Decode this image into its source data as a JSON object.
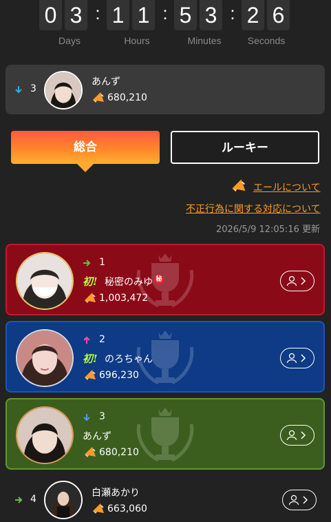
{
  "countdown": {
    "days": [
      "0",
      "3"
    ],
    "hours": [
      "1",
      "1"
    ],
    "minutes": [
      "5",
      "3"
    ],
    "seconds": [
      "2",
      "6"
    ],
    "labels": {
      "days": "Days",
      "hours": "Hours",
      "minutes": "Minutes",
      "seconds": "Seconds"
    }
  },
  "my_rank": {
    "rank": "3",
    "trend": "down",
    "name": "あんず",
    "points": "680,210"
  },
  "tabs": [
    {
      "label": "総合",
      "active": true
    },
    {
      "label": "ルーキー",
      "active": false
    }
  ],
  "links": {
    "yell_about": "エールについて",
    "fraud_policy": "不正行為に関する対応について"
  },
  "updated_at": "2026/5/9 12:05:16 更新",
  "ranking": [
    {
      "rank": "1",
      "trend": "flat",
      "first_badge": "初!",
      "name": "秘密のみゆ",
      "secret_badge": "秘",
      "points": "1,003,472",
      "card_color": "#8b0a18",
      "border_color": "#c4182a"
    },
    {
      "rank": "2",
      "trend": "up",
      "first_badge": "初!",
      "name": "のろちゃん",
      "points": "696,230",
      "card_color": "#0e3a86",
      "border_color": "#1a56c0"
    },
    {
      "rank": "3",
      "trend": "down",
      "name": "あんず",
      "points": "680,210",
      "card_color": "#3b5e1e",
      "border_color": "#5f9a2c"
    },
    {
      "rank": "4",
      "trend": "flat",
      "name": "白瀬あかり",
      "points": "663,060"
    }
  ],
  "colors": {
    "accent": "#ff9a2a",
    "up": "#ff4fa0",
    "down": "#3aa6e8",
    "flat": "#6cc04a"
  }
}
